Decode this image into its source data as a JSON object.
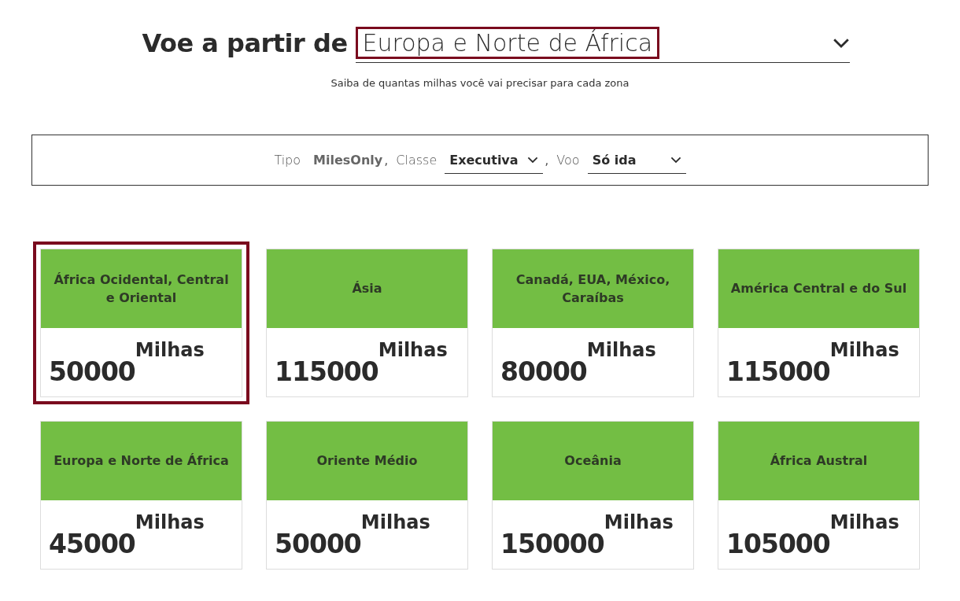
{
  "heading": {
    "label": "Voe a partir de",
    "region": "Europa e Norte de África",
    "highlighted": true
  },
  "subtitle": "Saiba de quantas milhas você vai precisar para cada zona",
  "filters": [
    {
      "kind": "static",
      "label": "Tipo",
      "value": "MilesOnly",
      "separator": ","
    },
    {
      "kind": "dropdown",
      "label": "Classe",
      "value": "Executiva",
      "separator": ","
    },
    {
      "kind": "dropdown",
      "label": "Voo",
      "value": "Só ida"
    }
  ],
  "zones": [
    {
      "name": "África Ocidental, Central e Oriental",
      "miles": "50000",
      "unit": "Milhas",
      "selected": true
    },
    {
      "name": "Ásia",
      "miles": "115000",
      "unit": "Milhas",
      "selected": false
    },
    {
      "name": "Canadá, EUA, México, Caraíbas",
      "miles": "80000",
      "unit": "Milhas",
      "selected": false
    },
    {
      "name": "América Central e do Sul",
      "miles": "115000",
      "unit": "Milhas",
      "selected": false
    },
    {
      "name": "Europa e Norte de África",
      "miles": "45000",
      "unit": "Milhas",
      "selected": false
    },
    {
      "name": "Oriente Médio",
      "miles": "50000",
      "unit": "Milhas",
      "selected": false
    },
    {
      "name": "Oceânia",
      "miles": "150000",
      "unit": "Milhas",
      "selected": false
    },
    {
      "name": "África Austral",
      "miles": "105000",
      "unit": "Milhas",
      "selected": false
    }
  ]
}
